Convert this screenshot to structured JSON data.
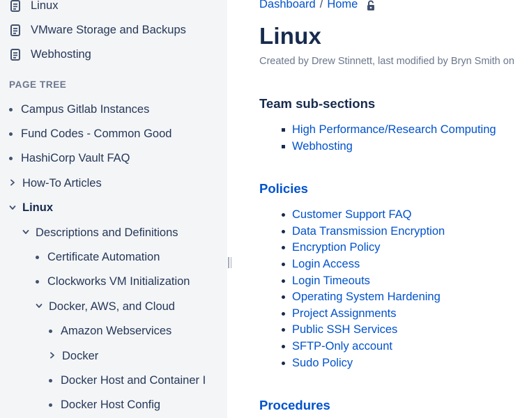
{
  "sidebar": {
    "pages": [
      {
        "label": "Linux"
      },
      {
        "label": "VMware Storage and Backups"
      },
      {
        "label": "Webhosting"
      }
    ],
    "page_tree_label": "PAGE TREE",
    "tree": [
      {
        "label": "Campus Gitlab Instances",
        "marker": "bullet",
        "bold": false
      },
      {
        "label": "Fund Codes - Common Good",
        "marker": "bullet",
        "bold": false
      },
      {
        "label": "HashiCorp Vault FAQ",
        "marker": "bullet",
        "bold": false
      },
      {
        "label": "How-To Articles",
        "marker": "chevron-right",
        "bold": false
      },
      {
        "label": "Linux",
        "marker": "chevron-down",
        "bold": true
      },
      {
        "label": "Descriptions and Definitions",
        "marker": "chevron-down",
        "bold": false
      },
      {
        "label": "Certificate Automation",
        "marker": "bullet",
        "bold": false
      },
      {
        "label": "Clockworks VM Initialization",
        "marker": "bullet",
        "bold": false
      },
      {
        "label": "Docker, AWS, and Cloud",
        "marker": "chevron-down",
        "bold": false
      },
      {
        "label": "Amazon Webservices",
        "marker": "bullet",
        "bold": false
      },
      {
        "label": "Docker",
        "marker": "chevron-right",
        "bold": false
      },
      {
        "label": "Docker Host and Container I",
        "marker": "bullet",
        "bold": false
      },
      {
        "label": "Docker Host Config",
        "marker": "bullet",
        "bold": false
      }
    ]
  },
  "breadcrumb": {
    "items": [
      "Dashboard",
      "Home"
    ],
    "separator": "/"
  },
  "page": {
    "title": "Linux",
    "byline": "Created by Drew Stinnett, last modified by Bryn Smith on"
  },
  "sections": [
    {
      "heading": "Team sub-sections",
      "style": "dark",
      "bullet": "square",
      "links": [
        "High Performance/Research Computing",
        "Webhosting"
      ]
    },
    {
      "heading": "Policies",
      "style": "blue",
      "bullet": "dot",
      "links": [
        "Customer Support FAQ",
        "Data Transmission Encryption",
        "Encryption Policy",
        "Login Access",
        "Login Timeouts",
        "Operating System Hardening",
        "Project Assignments",
        "Public SSH Services",
        "SFTP-Only account",
        "Sudo Policy"
      ]
    },
    {
      "heading": "Procedures",
      "style": "blue",
      "bullet": "dot",
      "links": []
    }
  ],
  "colors": {
    "link": "#0052cc",
    "text": "#172b4d",
    "muted": "#6b778c",
    "sidebar_bg": "#f4f5f7"
  }
}
